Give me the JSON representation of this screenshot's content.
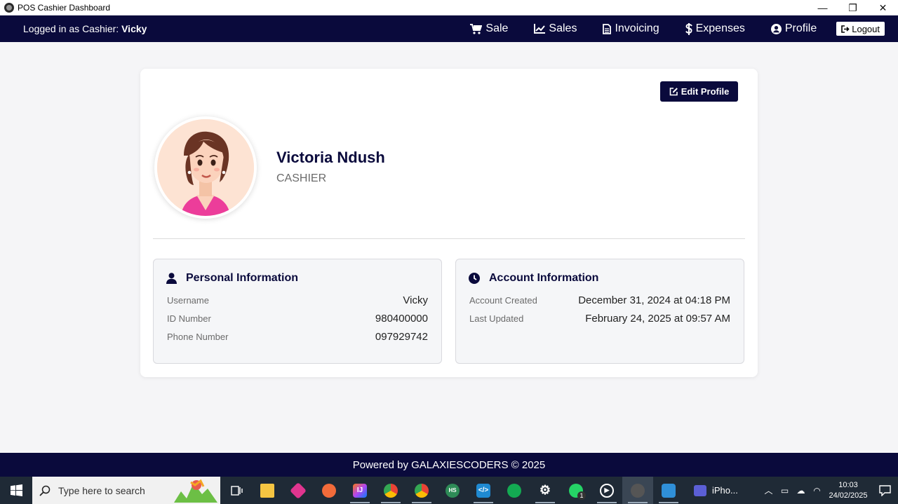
{
  "window": {
    "title": "POS Cashier Dashboard",
    "controls": {
      "minimize": "—",
      "restore": "❐",
      "close": "✕"
    }
  },
  "navbar": {
    "logged_prefix": "Logged in as Cashier: ",
    "logged_user": "Vicky",
    "items": [
      {
        "label": "Sale",
        "icon": "cart-icon"
      },
      {
        "label": "Sales",
        "icon": "chart-icon"
      },
      {
        "label": "Invoicing",
        "icon": "document-icon"
      },
      {
        "label": "Expenses",
        "icon": "dollar-icon"
      },
      {
        "label": "Profile",
        "icon": "user-circle-icon"
      }
    ],
    "logout_label": "Logout"
  },
  "profile": {
    "edit_label": "Edit Profile",
    "name": "Victoria Ndush",
    "role": "CASHIER"
  },
  "personal_info": {
    "heading": "Personal Information",
    "rows": [
      {
        "label": "Username",
        "value": "Vicky"
      },
      {
        "label": "ID Number",
        "value": "980400000"
      },
      {
        "label": "Phone Number",
        "value": "097929742"
      }
    ]
  },
  "account_info": {
    "heading": "Account Information",
    "rows": [
      {
        "label": "Account Created",
        "value": "December 31, 2024 at 04:18 PM"
      },
      {
        "label": "Last Updated",
        "value": "February 24, 2025 at 09:57 AM"
      }
    ]
  },
  "footer": {
    "text": "Powered by GALAXIESCODERS © 2025"
  },
  "taskbar": {
    "search_placeholder": "Type here to search",
    "iphone_label": "iPho...",
    "whatsapp_badge": "1",
    "time": "10:03",
    "date": "24/02/2025"
  },
  "colors": {
    "primary": "#0a0a3c",
    "card_bg": "#ffffff",
    "page_bg": "#f5f5f7",
    "info_bg": "#f5f6f8",
    "taskbar": "#1f2a36"
  }
}
